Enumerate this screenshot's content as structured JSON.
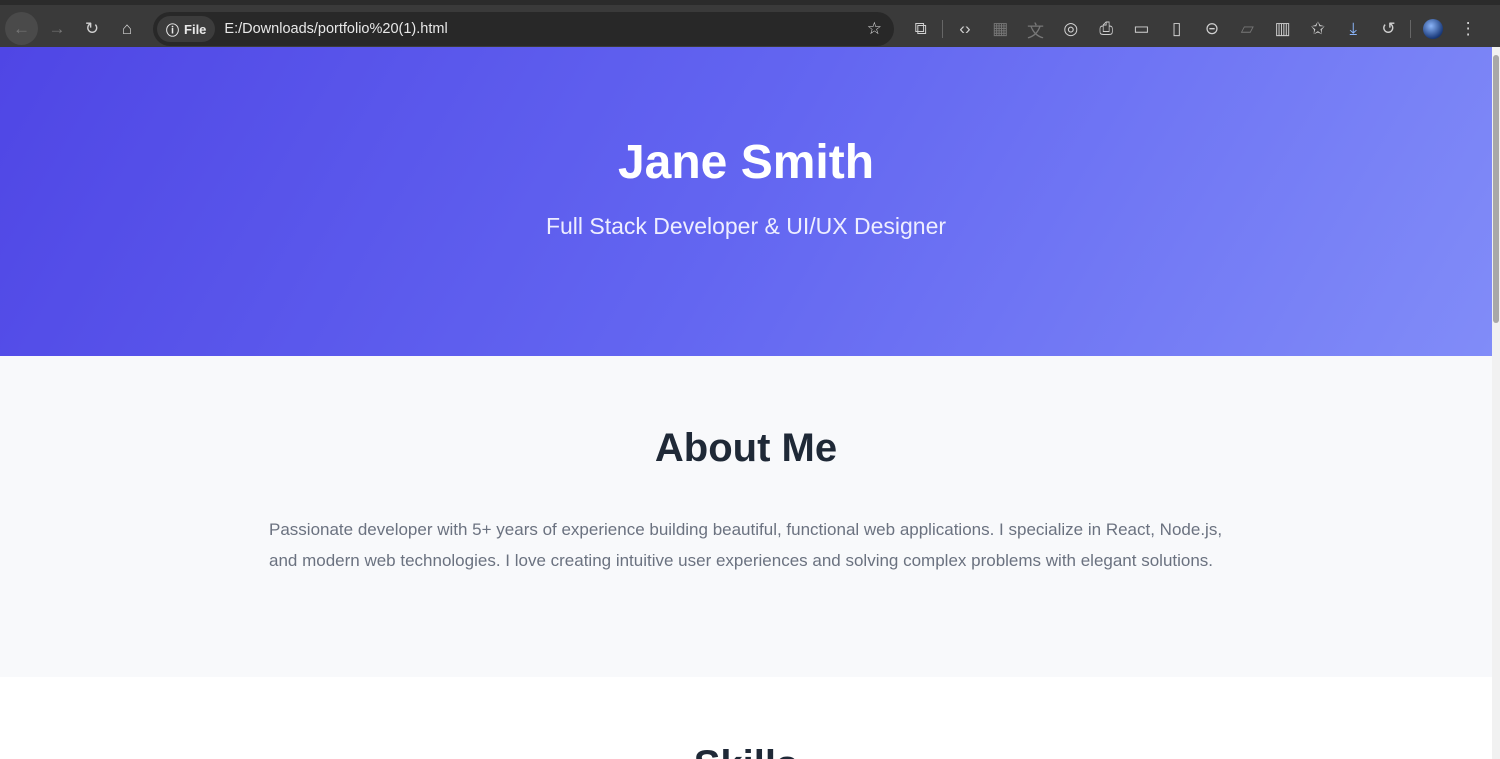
{
  "browser": {
    "url_chip": "File",
    "url": "E:/Downloads/portfolio%20(1).html"
  },
  "hero": {
    "name": "Jane Smith",
    "tagline": "Full Stack Developer & UI/UX Designer"
  },
  "about": {
    "heading": "About Me",
    "text": "Passionate developer with 5+ years of experience building beautiful, functional web applications. I specialize in React, Node.js, and modern web technologies. I love creating intuitive user experiences and solving complex problems with elegant solutions."
  },
  "skills": {
    "heading": "Skills"
  },
  "colors": {
    "hero_start": "#4f46e5",
    "hero_end": "#818cf8",
    "heading": "#1f2937",
    "body_text": "#6b7280"
  }
}
